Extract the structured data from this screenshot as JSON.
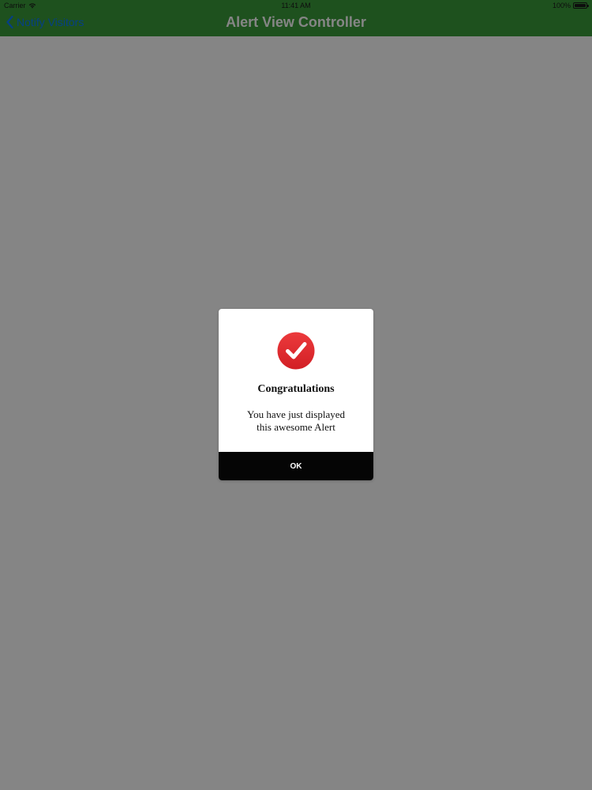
{
  "status_bar": {
    "carrier": "Carrier",
    "time": "11:41 AM",
    "battery_percent": "100%",
    "battery_level": 1.0
  },
  "nav": {
    "back_label": "Notify Visitors",
    "title": "Alert View Controller"
  },
  "alert": {
    "icon": "checkmark-circle-icon",
    "title": "Congratulations",
    "message_line1": "You have just displayed",
    "message_line2": "this awesome Alert",
    "button_label": "OK"
  },
  "colors": {
    "nav_bar": "#3b9b3b",
    "back_link": "#0a7aff",
    "alert_icon": "#e02a2e",
    "alert_button": "#050505",
    "overlay": "rgba(0,0,0,0.48)"
  }
}
